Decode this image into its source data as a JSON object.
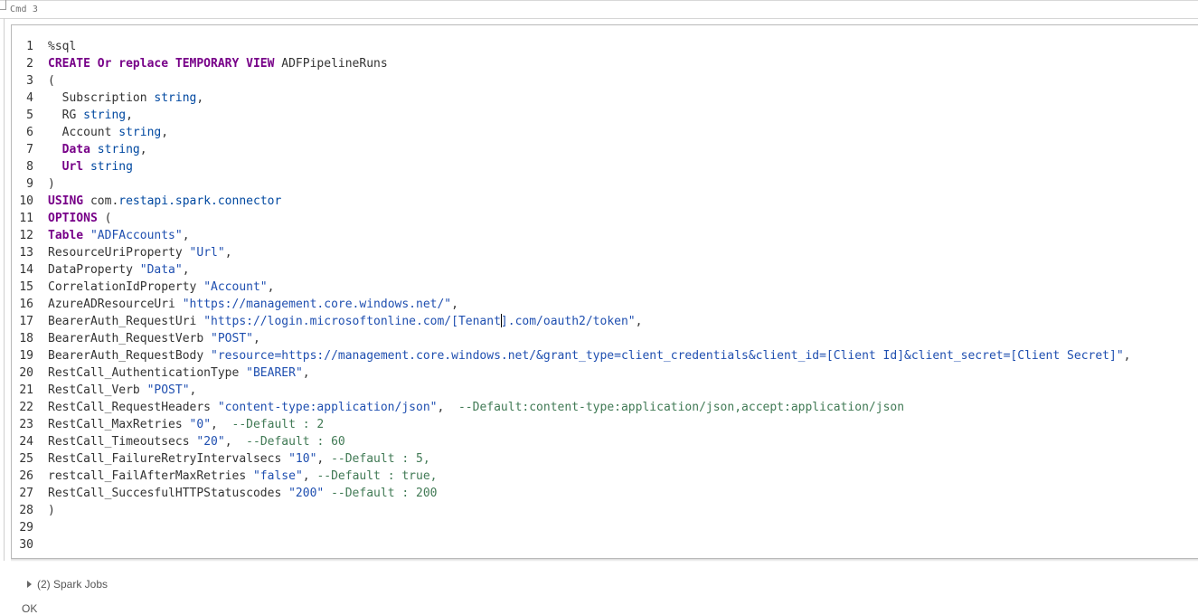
{
  "cell": {
    "label": "Cmd 3"
  },
  "editor": {
    "line_numbers": [
      "1",
      "2",
      "3",
      "4",
      "5",
      "6",
      "7",
      "8",
      "9",
      "10",
      "11",
      "12",
      "13",
      "14",
      "15",
      "16",
      "17",
      "18",
      "19",
      "20",
      "21",
      "22",
      "23",
      "24",
      "25",
      "26",
      "27",
      "28",
      "29",
      "30"
    ],
    "lines": [
      [
        {
          "t": "%sql",
          "c": "plain"
        }
      ],
      [
        {
          "t": "CREATE Or replace TEMPORARY VIEW",
          "c": "kw"
        },
        {
          "t": " ADFPipelineRuns",
          "c": "plain"
        }
      ],
      [
        {
          "t": "(",
          "c": "plain"
        }
      ],
      [
        {
          "t": "  Subscription ",
          "c": "plain"
        },
        {
          "t": "string",
          "c": "ty"
        },
        {
          "t": ",",
          "c": "plain"
        }
      ],
      [
        {
          "t": "  RG ",
          "c": "plain"
        },
        {
          "t": "string",
          "c": "ty"
        },
        {
          "t": ",",
          "c": "plain"
        }
      ],
      [
        {
          "t": "  Account ",
          "c": "plain"
        },
        {
          "t": "string",
          "c": "ty"
        },
        {
          "t": ",",
          "c": "plain"
        }
      ],
      [
        {
          "t": "  ",
          "c": "plain"
        },
        {
          "t": "Data",
          "c": "kw"
        },
        {
          "t": " ",
          "c": "plain"
        },
        {
          "t": "string",
          "c": "ty"
        },
        {
          "t": ",",
          "c": "plain"
        }
      ],
      [
        {
          "t": "  ",
          "c": "plain"
        },
        {
          "t": "Url",
          "c": "kw"
        },
        {
          "t": " ",
          "c": "plain"
        },
        {
          "t": "string",
          "c": "ty"
        }
      ],
      [
        {
          "t": ")",
          "c": "plain"
        }
      ],
      [
        {
          "t": "USING",
          "c": "kw"
        },
        {
          "t": " com.",
          "c": "plain"
        },
        {
          "t": "restapi.spark.connector",
          "c": "ty"
        }
      ],
      [
        {
          "t": "OPTIONS",
          "c": "kw"
        },
        {
          "t": " (",
          "c": "plain"
        }
      ],
      [
        {
          "t": "Table",
          "c": "kw"
        },
        {
          "t": " ",
          "c": "plain"
        },
        {
          "t": "\"ADFAccounts\"",
          "c": "str"
        },
        {
          "t": ",",
          "c": "plain"
        }
      ],
      [
        {
          "t": "ResourceUriProperty ",
          "c": "plain"
        },
        {
          "t": "\"Url\"",
          "c": "str"
        },
        {
          "t": ",",
          "c": "plain"
        }
      ],
      [
        {
          "t": "DataProperty ",
          "c": "plain"
        },
        {
          "t": "\"Data\"",
          "c": "str"
        },
        {
          "t": ",",
          "c": "plain"
        }
      ],
      [
        {
          "t": "CorrelationIdProperty ",
          "c": "plain"
        },
        {
          "t": "\"Account\"",
          "c": "str"
        },
        {
          "t": ",",
          "c": "plain"
        }
      ],
      [
        {
          "t": "AzureADResourceUri ",
          "c": "plain"
        },
        {
          "t": "\"https://management.core.windows.net/\"",
          "c": "str"
        },
        {
          "t": ",",
          "c": "plain"
        }
      ],
      [
        {
          "t": "BearerAuth_RequestUri ",
          "c": "plain"
        },
        {
          "t": "\"https://login.microsoftonline.com/[Tenant",
          "c": "str"
        },
        {
          "t": "",
          "c": "cursor"
        },
        {
          "t": "].com/oauth2/token\"",
          "c": "str"
        },
        {
          "t": ",",
          "c": "plain"
        }
      ],
      [
        {
          "t": "BearerAuth_RequestVerb ",
          "c": "plain"
        },
        {
          "t": "\"POST\"",
          "c": "str"
        },
        {
          "t": ",",
          "c": "plain"
        }
      ],
      [
        {
          "t": "BearerAuth_RequestBody ",
          "c": "plain"
        },
        {
          "t": "\"resource=https://management.core.windows.net/&grant_type=client_credentials&client_id=[Client Id]&client_secret=[Client Secret]\"",
          "c": "str"
        },
        {
          "t": ",",
          "c": "plain"
        }
      ],
      [
        {
          "t": "RestCall_AuthenticationType ",
          "c": "plain"
        },
        {
          "t": "\"BEARER\"",
          "c": "str"
        },
        {
          "t": ",",
          "c": "plain"
        }
      ],
      [
        {
          "t": "RestCall_Verb ",
          "c": "plain"
        },
        {
          "t": "\"POST\"",
          "c": "str"
        },
        {
          "t": ",",
          "c": "plain"
        }
      ],
      [
        {
          "t": "RestCall_RequestHeaders ",
          "c": "plain"
        },
        {
          "t": "\"content-type:application/json\"",
          "c": "str"
        },
        {
          "t": ",  ",
          "c": "plain"
        },
        {
          "t": "--Default:content-type:application/json,accept:application/json",
          "c": "cm"
        }
      ],
      [
        {
          "t": "RestCall_MaxRetries ",
          "c": "plain"
        },
        {
          "t": "\"0\"",
          "c": "str"
        },
        {
          "t": ",  ",
          "c": "plain"
        },
        {
          "t": "--Default : 2",
          "c": "cm"
        }
      ],
      [
        {
          "t": "RestCall_Timeoutsecs ",
          "c": "plain"
        },
        {
          "t": "\"20\"",
          "c": "str"
        },
        {
          "t": ",  ",
          "c": "plain"
        },
        {
          "t": "--Default : 60",
          "c": "cm"
        }
      ],
      [
        {
          "t": "RestCall_FailureRetryIntervalsecs ",
          "c": "plain"
        },
        {
          "t": "\"10\"",
          "c": "str"
        },
        {
          "t": ", ",
          "c": "plain"
        },
        {
          "t": "--Default : 5,",
          "c": "cm"
        }
      ],
      [
        {
          "t": "restcall_FailAfterMaxRetries ",
          "c": "plain"
        },
        {
          "t": "\"false\"",
          "c": "str"
        },
        {
          "t": ", ",
          "c": "plain"
        },
        {
          "t": "--Default : true,",
          "c": "cm"
        }
      ],
      [
        {
          "t": "RestCall_SuccesfulHTTPStatuscodes ",
          "c": "plain"
        },
        {
          "t": "\"200\"",
          "c": "str"
        },
        {
          "t": " ",
          "c": "plain"
        },
        {
          "t": "--Default : 200",
          "c": "cm"
        }
      ],
      [
        {
          "t": ")",
          "c": "plain"
        }
      ],
      [
        {
          "t": "",
          "c": "plain"
        }
      ],
      [
        {
          "t": "",
          "c": "plain"
        }
      ]
    ]
  },
  "output": {
    "spark_jobs_label": "(2) Spark Jobs",
    "result_text": "OK"
  },
  "colors": {
    "keyword": "#770088",
    "type": "#0048a0",
    "string": "#1f4fb0",
    "comment": "#417a55"
  }
}
